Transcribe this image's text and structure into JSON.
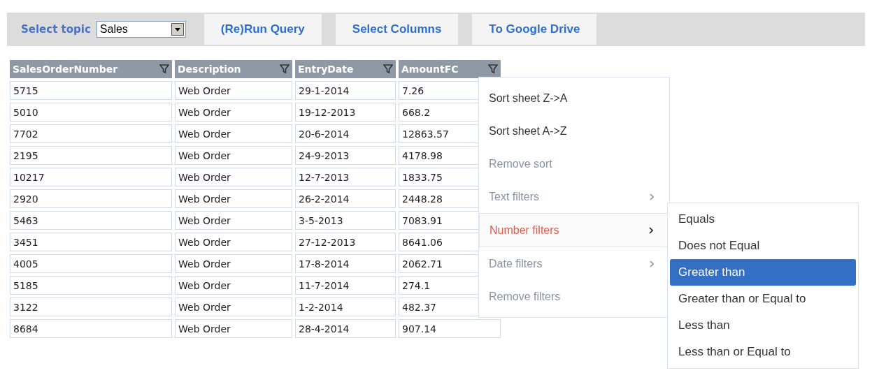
{
  "toolbar": {
    "topic_label": "Select topic",
    "topic_value": "Sales",
    "buttons": [
      "(Re)Run Query",
      "Select Columns",
      "To Google Drive"
    ]
  },
  "table": {
    "columns": [
      "SalesOrderNumber",
      "Description",
      "EntryDate",
      "AmountFC"
    ],
    "rows": [
      [
        "5715",
        "Web Order",
        "29-1-2014",
        "7.26"
      ],
      [
        "5010",
        "Web Order",
        "19-12-2013",
        "668.2"
      ],
      [
        "7702",
        "Web Order",
        "20-6-2014",
        "12863.57"
      ],
      [
        "2195",
        "Web Order",
        "24-9-2013",
        "4178.98"
      ],
      [
        "10217",
        "Web Order",
        "12-7-2013",
        "1833.75"
      ],
      [
        "2920",
        "Web Order",
        "26-2-2014",
        "2448.28"
      ],
      [
        "5463",
        "Web Order",
        "3-5-2013",
        "7083.91"
      ],
      [
        "3451",
        "Web Order",
        "27-12-2013",
        "8641.06"
      ],
      [
        "4005",
        "Web Order",
        "17-8-2014",
        "2062.71"
      ],
      [
        "5185",
        "Web Order",
        "11-7-2014",
        "274.1"
      ],
      [
        "3122",
        "Web Order",
        "1-2-2014",
        "482.37"
      ],
      [
        "8684",
        "Web Order",
        "28-4-2014",
        "907.14"
      ]
    ]
  },
  "filter_menu": {
    "items": [
      {
        "label": "Sort sheet Z->A",
        "disabled": false,
        "submenu": false,
        "selected": false
      },
      {
        "label": "Sort sheet A->Z",
        "disabled": false,
        "submenu": false,
        "selected": false
      },
      {
        "label": "Remove sort",
        "disabled": true,
        "submenu": false,
        "selected": false
      },
      {
        "label": "Text filters",
        "disabled": true,
        "submenu": true,
        "selected": false
      },
      {
        "label": "Number filters",
        "disabled": false,
        "submenu": true,
        "selected": true
      },
      {
        "label": "Date filters",
        "disabled": true,
        "submenu": true,
        "selected": false
      },
      {
        "label": "Remove filters",
        "disabled": true,
        "submenu": false,
        "selected": false
      }
    ]
  },
  "number_filters_menu": {
    "items": [
      {
        "label": "Equals",
        "selected": false
      },
      {
        "label": "Does not Equal",
        "selected": false
      },
      {
        "label": "Greater than",
        "selected": true
      },
      {
        "label": "Greater than or Equal to",
        "selected": false
      },
      {
        "label": "Less than",
        "selected": false
      },
      {
        "label": "Less than or Equal to",
        "selected": false
      }
    ]
  }
}
